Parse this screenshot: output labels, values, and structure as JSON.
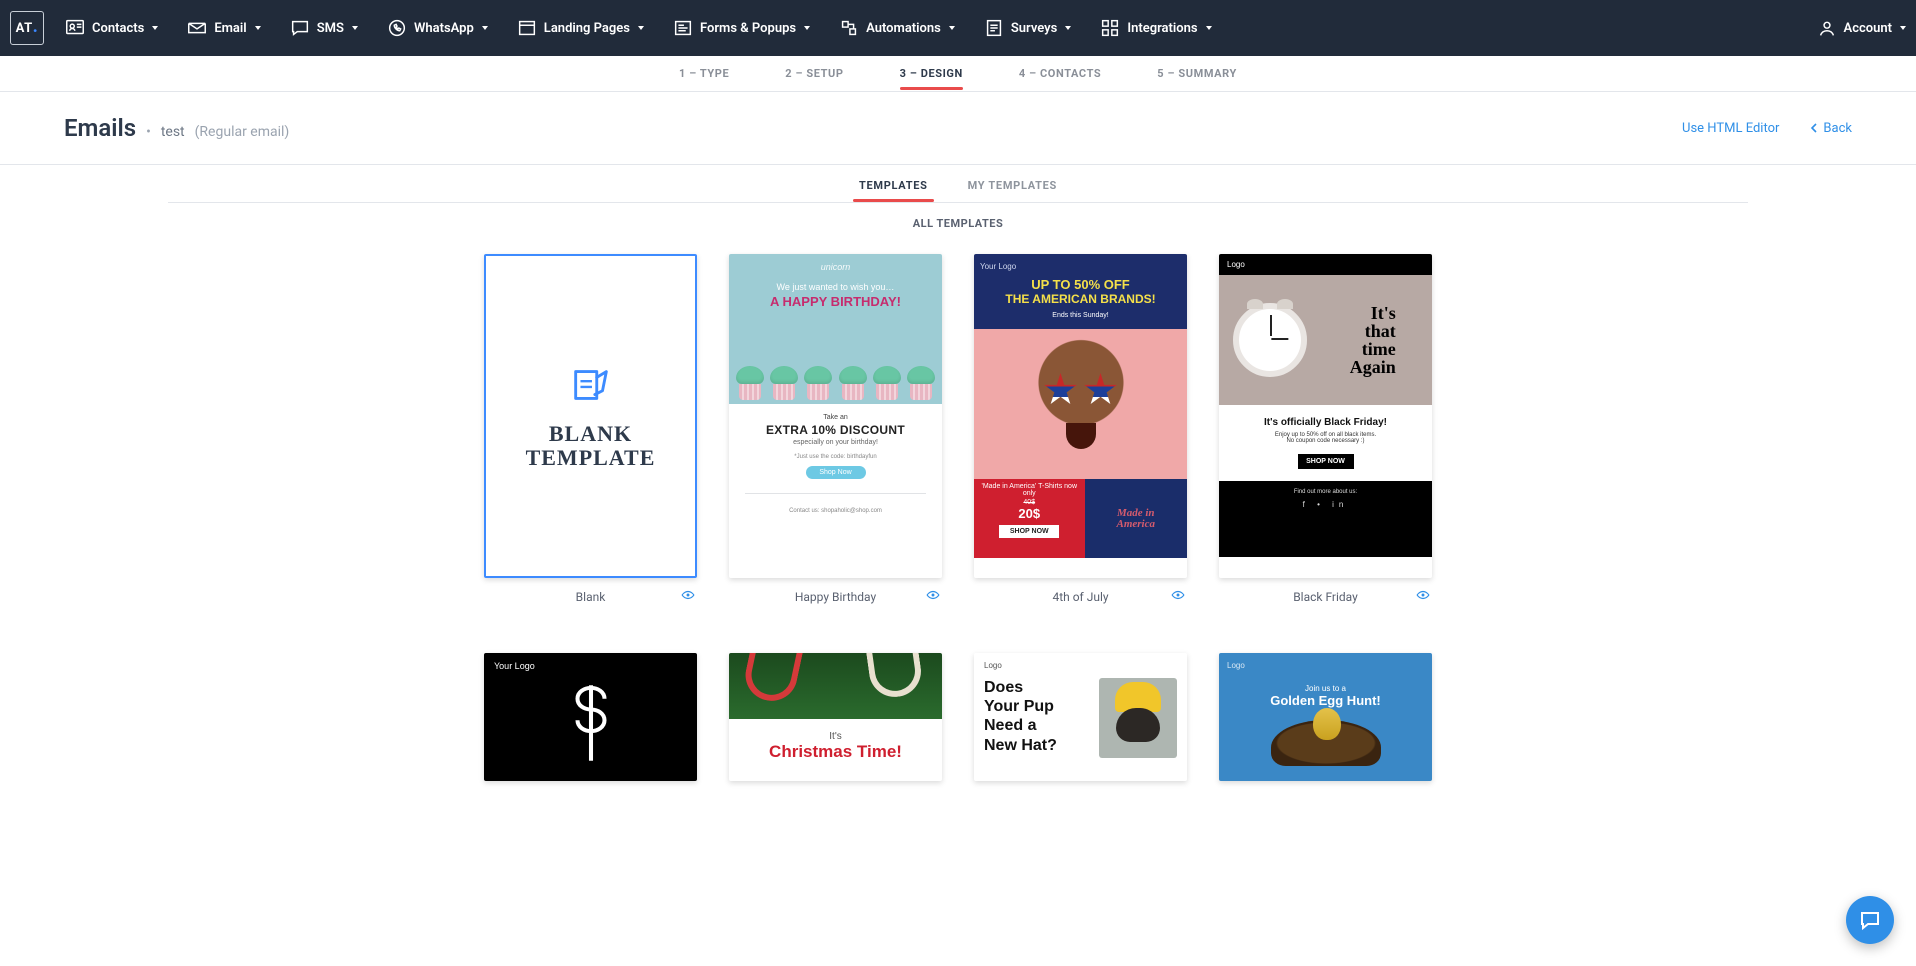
{
  "nav": {
    "items": [
      {
        "label": "Contacts"
      },
      {
        "label": "Email"
      },
      {
        "label": "SMS"
      },
      {
        "label": "WhatsApp"
      },
      {
        "label": "Landing Pages"
      },
      {
        "label": "Forms & Popups"
      },
      {
        "label": "Automations"
      },
      {
        "label": "Surveys"
      },
      {
        "label": "Integrations"
      }
    ],
    "account": "Account"
  },
  "steps": [
    {
      "label": "1 – TYPE"
    },
    {
      "label": "2 – SETUP"
    },
    {
      "label": "3 – DESIGN",
      "active": true
    },
    {
      "label": "4 – CONTACTS"
    },
    {
      "label": "5 – SUMMARY"
    }
  ],
  "header": {
    "title": "Emails",
    "dot": "•",
    "name": "test",
    "type": "(Regular email)",
    "use_html": "Use HTML Editor",
    "back": "Back"
  },
  "tabs": {
    "templates": "TEMPLATES",
    "my_templates": "MY TEMPLATES",
    "all": "ALL TEMPLATES"
  },
  "cards": {
    "blank": {
      "caption": "Blank",
      "label_top": "BLANK",
      "label_bot": "TEMPLATE"
    },
    "bday": {
      "caption": "Happy Birthday",
      "logo": "unicorn",
      "wish": "We just wanted to wish you…",
      "hb": "A HAPPY BIRTHDAY!",
      "take": "Take an",
      "extra": "EXTRA 10% DISCOUNT",
      "esp": "especially on your birthday!",
      "code": "*Just use the code: birthdayfun",
      "shop": "Shop Now",
      "contact": "Contact us: shopaholic@shop.com"
    },
    "july": {
      "caption": "4th of July",
      "your_logo": "Your Logo",
      "upto": "UP TO 50% OFF",
      "brands": "THE AMERICAN BRANDS!",
      "ends": "Ends this Sunday!",
      "t1": "'Made in America' T-Shirts now only",
      "t2": "40$",
      "t3": "20$",
      "shop": "SHOP NOW",
      "mia_top": "Made in",
      "mia_bot": "America"
    },
    "bf": {
      "caption": "Black Friday",
      "logo": "Logo",
      "tta": "It's that time Again",
      "t1": "It's officially Black Friday!",
      "t2": "Enjoy up to 50% off on all black items.",
      "t3": "No coupon code necessary :)",
      "shop": "SHOP NOW",
      "find": "Find out more about us:",
      "dots": "f • in"
    },
    "yl": {
      "your_logo": "Your Logo"
    },
    "xmas": {
      "its": "It's",
      "ct": "Christmas Time!"
    },
    "pup": {
      "logo": "Logo",
      "q_l1": "Does",
      "q_l2": "Your Pup",
      "q_l3": "Need a",
      "q_l4": "New Hat?"
    },
    "egg": {
      "logo": "Logo",
      "join": "Join us to a",
      "hunt": "Golden Egg Hunt!"
    }
  }
}
